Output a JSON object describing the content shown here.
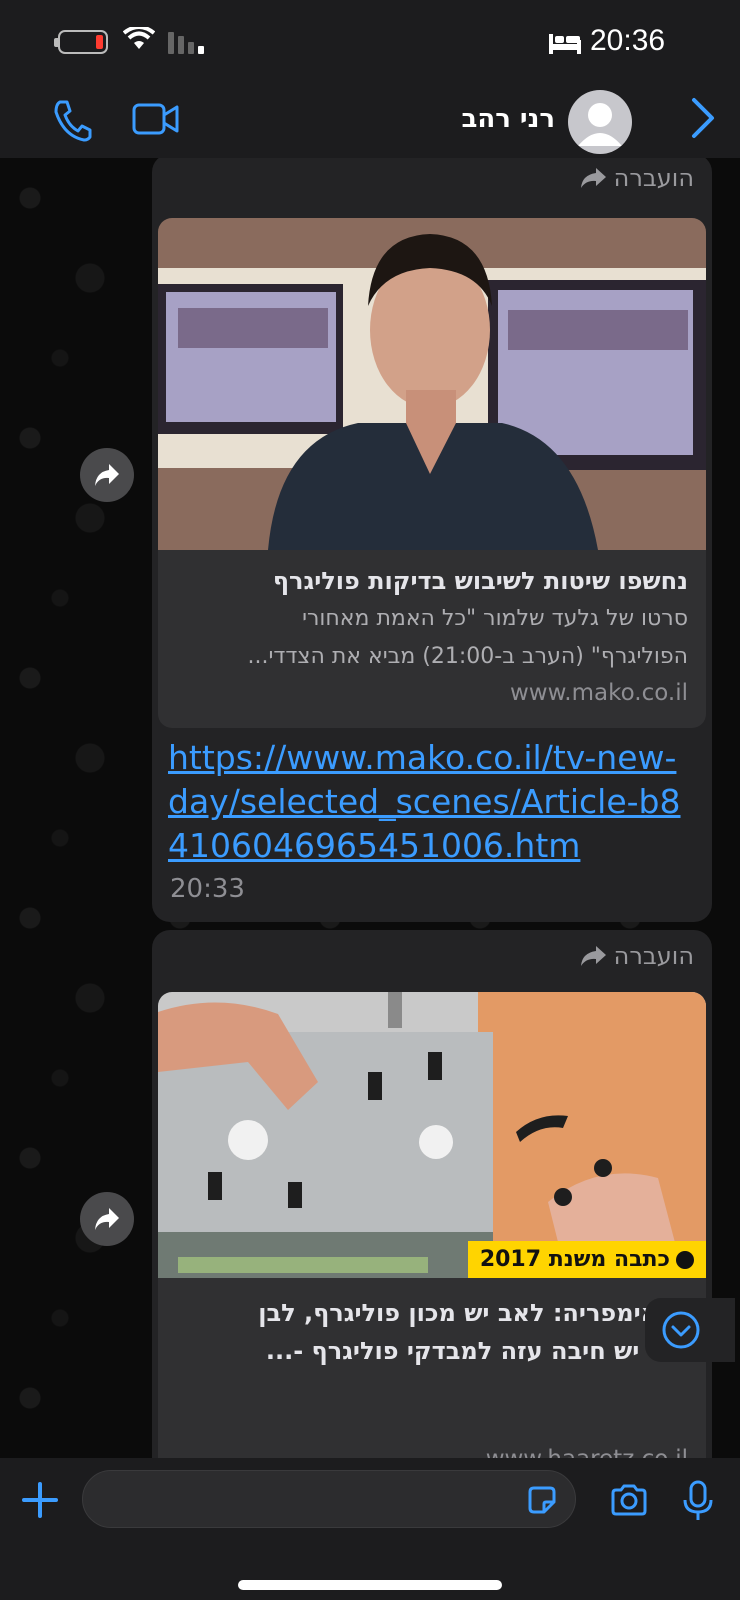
{
  "status_bar": {
    "time": "20:36"
  },
  "header": {
    "contact_name": "רני רהב"
  },
  "messages": [
    {
      "forwarded_label": "הועברה",
      "preview_title": "נחשפו שיטות לשיבוש בדיקות פוליגרף",
      "preview_desc_line1": "סרטו של גלעד שלמור \"כל האמת מאחורי",
      "preview_desc_line2": "הפוליגרף\" (הערב ב-21:00) מביא את הצדדי...",
      "preview_domain": "www.mako.co.il",
      "link": "https://www.mako.co.il/tv-new-day/selected_scenes/Article-b84106046965451006.htm",
      "time": "20:33"
    },
    {
      "forwarded_label": "הועברה",
      "badge": "כתבה משנת 2017",
      "preview_title_line1": "רי אימפריה: לאב יש מכון פוליגרף, לבן",
      "preview_title_line2": "ופט יש חיבה עזה למבדקי פוליגרף -...",
      "preview_domain": "www.haaretz.co.il"
    }
  ],
  "colors": {
    "accent": "#3b9cff",
    "bubble": "#232325",
    "badge": "#ffd400"
  }
}
